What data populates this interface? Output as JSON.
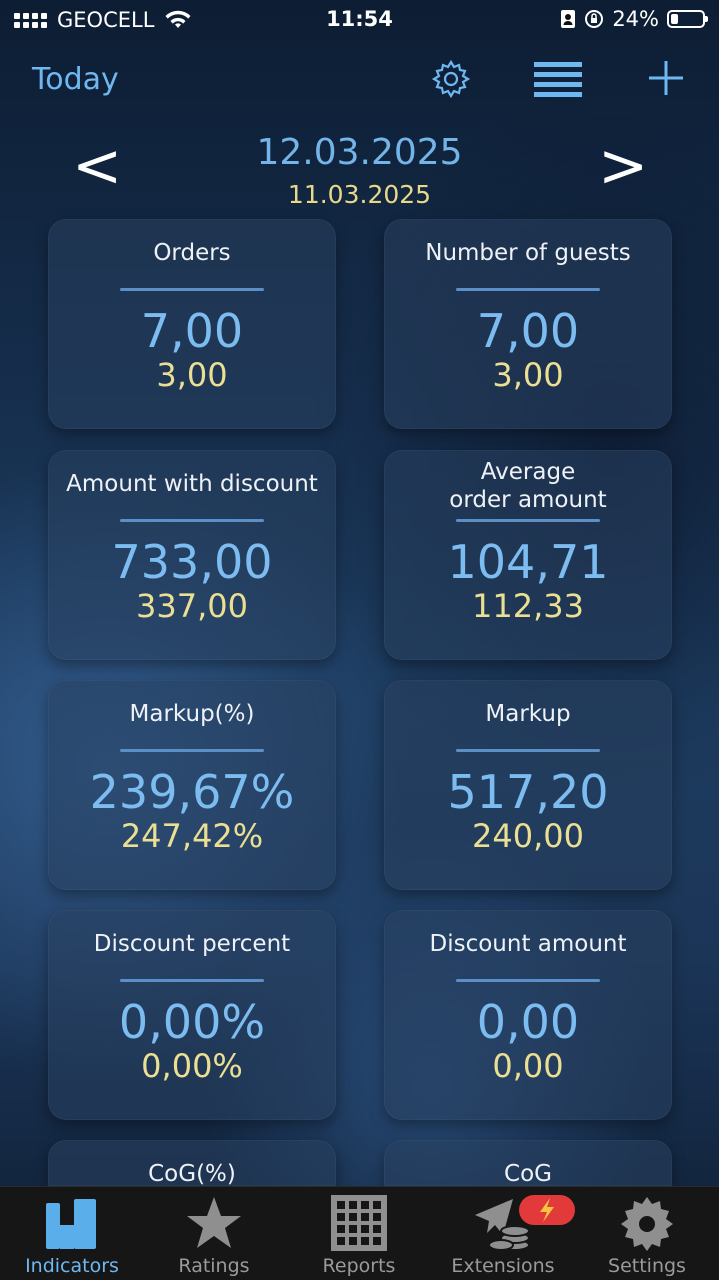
{
  "status_bar": {
    "carrier": "GEOCELL",
    "time": "11:54",
    "battery_percent": "24%",
    "battery_level": 0.24
  },
  "nav": {
    "today_label": "Today",
    "icons": [
      "gear-icon",
      "list-icon",
      "plus-icon"
    ]
  },
  "date_switcher": {
    "prev_label": "<",
    "next_label": ">",
    "current_date": "12.03.2025",
    "compare_date": "11.03.2025"
  },
  "cards": [
    {
      "title": "Orders",
      "value": "7,00",
      "previous": "3,00"
    },
    {
      "title": "Number of guests",
      "value": "7,00",
      "previous": "3,00"
    },
    {
      "title": "Amount with discount",
      "value": "733,00",
      "previous": "337,00"
    },
    {
      "title_line1": "Average",
      "title_line2": "order amount",
      "value": "104,71",
      "previous": "112,33"
    },
    {
      "title": "Markup(%)",
      "value": "239,67%",
      "previous": "247,42%"
    },
    {
      "title": "Markup",
      "value": "517,20",
      "previous": "240,00"
    },
    {
      "title": "Discount percent",
      "value": "0,00%",
      "previous": "0,00%"
    },
    {
      "title": "Discount amount",
      "value": "0,00",
      "previous": "0,00"
    },
    {
      "title": "CoG(%)"
    },
    {
      "title": "CoG"
    }
  ],
  "tab_bar": {
    "tabs": [
      {
        "label": "Indicators",
        "icon": "indicators-icon",
        "active": true
      },
      {
        "label": "Ratings",
        "icon": "star-icon",
        "active": false
      },
      {
        "label": "Reports",
        "icon": "grid-icon",
        "active": false
      },
      {
        "label": "Extensions",
        "icon": "extensions-icon",
        "active": false
      },
      {
        "label": "Settings",
        "icon": "gear-icon",
        "active": false
      }
    ]
  },
  "colors": {
    "accent": "#6fb7f0",
    "value_blue": "#7cbcf0",
    "previous_yellow": "#eadf92",
    "badge_red": "#e23a3a"
  }
}
